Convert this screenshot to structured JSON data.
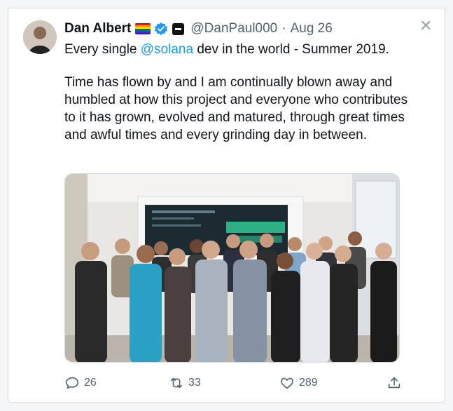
{
  "author": {
    "name": "Dan Albert",
    "handle": "@DanPaul000",
    "separator": "·",
    "date": "Aug 26",
    "badges": [
      "rainbow-flag-icon",
      "verified-badge-icon",
      "affiliation-badge-icon"
    ]
  },
  "tweet": {
    "line1_prefix": "Every single ",
    "mention": "@solana",
    "line1_suffix": " dev in the world - Summer 2019.",
    "paragraph2": "Time has flown by and I am continually blown away and humbled at how this project and everyone who contributes to it has grown, evolved and matured, through great times and awful times and every grinding day in between."
  },
  "actions": {
    "reply_count": "26",
    "retweet_count": "33",
    "like_count": "289"
  },
  "colors": {
    "link": "#1d9bf0",
    "muted": "#536471",
    "text": "#0f1419",
    "border": "#cfd9de"
  },
  "icons": [
    "close-icon",
    "reply-icon",
    "retweet-icon",
    "like-icon",
    "share-icon"
  ]
}
